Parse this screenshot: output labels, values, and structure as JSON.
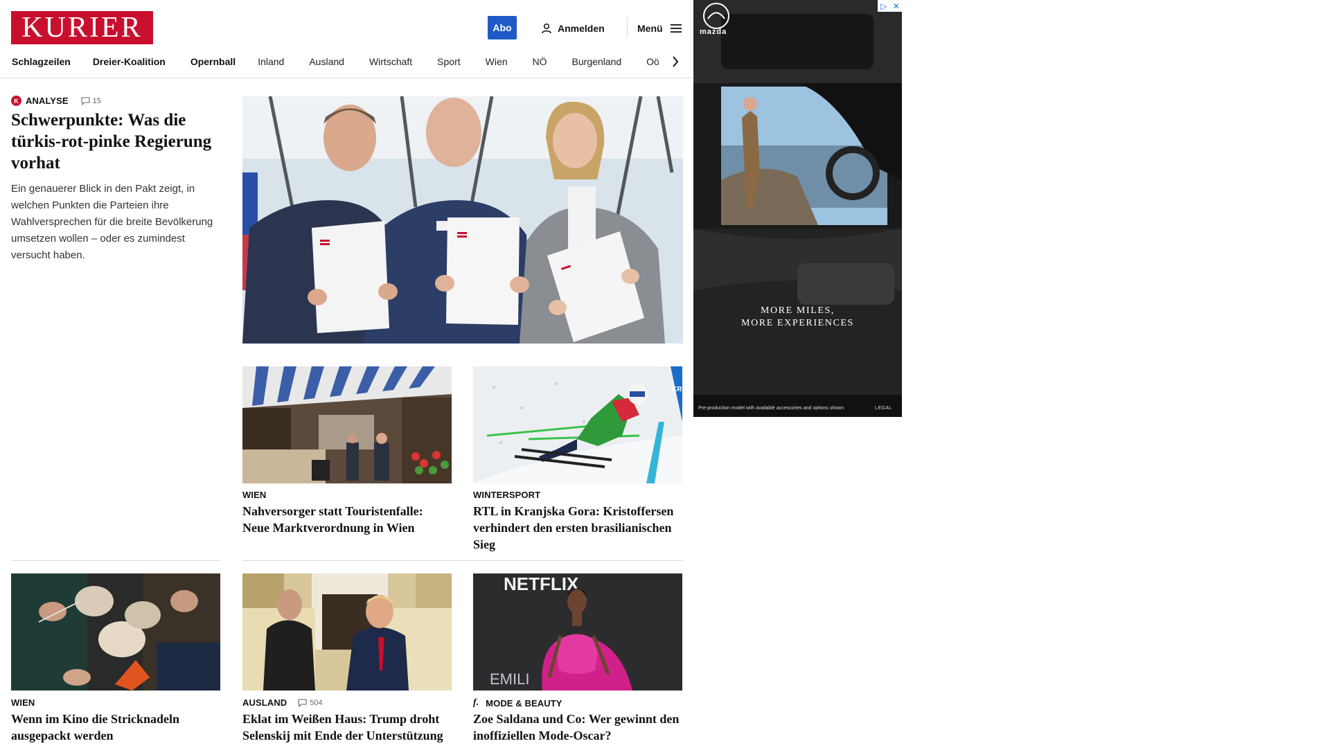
{
  "brand": {
    "logo_text": "KURIER",
    "color": "#c8102e"
  },
  "header": {
    "abo_label": "Abo",
    "login_label": "Anmelden",
    "menu_label": "Menü",
    "accent": "#1e5bc6"
  },
  "nav": {
    "items": [
      "Schlagzeilen",
      "Dreier-Koalition",
      "Opernball",
      "Inland",
      "Ausland",
      "Wirtschaft",
      "Sport",
      "Wien",
      "NÖ",
      "Burgenland",
      "Oö"
    ]
  },
  "lead": {
    "kicker": "ANALYSE",
    "badge": "K",
    "comments": "15",
    "title": "Schwerpunkte: Was die türkis-rot-pinke Regierung vorhat",
    "teaser": "Ein genauerer Blick in den Pakt zeigt, in welchen Punkten die Parteien ihre Wahlversprechen für die breite Bevölkerung umsetzen wollen – oder es zumindest versucht haben."
  },
  "articles": [
    {
      "kicker": "WIEN",
      "title": "Nahversorger statt Touristenfalle: Neue Marktverordnung in Wien"
    },
    {
      "kicker": "WINTERSPORT",
      "title": "RTL in Kranjska Gora: Kristoffersen verhindert den ersten brasilianischen Sieg"
    },
    {
      "kicker": "WIEN",
      "title": "Wenn im Kino die Stricknadeln ausgepackt werden"
    },
    {
      "kicker": "AUSLAND",
      "comments": "504",
      "title": "Eklat im Weißen Haus: Trump droht Selenskij mit Ende der Unterstützung"
    },
    {
      "kicker": "MODE & BEAUTY",
      "badge": "f.",
      "title": "Zoe Saldana und Co: Wer gewinnt den inoffiziellen Mode-Oscar?"
    }
  ],
  "photo_text": {
    "netflix": "NETFLIX",
    "backdrop": "EMILI",
    "ski_banner": "KR"
  },
  "ad": {
    "brand": "mazda",
    "claim_line1": "MORE MILES,",
    "claim_line2": "MORE EXPERIENCES",
    "disclaimer": "Pre-production model with available accessories and options shown",
    "legal": "LEGAL",
    "info_icons": [
      "▷",
      "✕"
    ]
  }
}
